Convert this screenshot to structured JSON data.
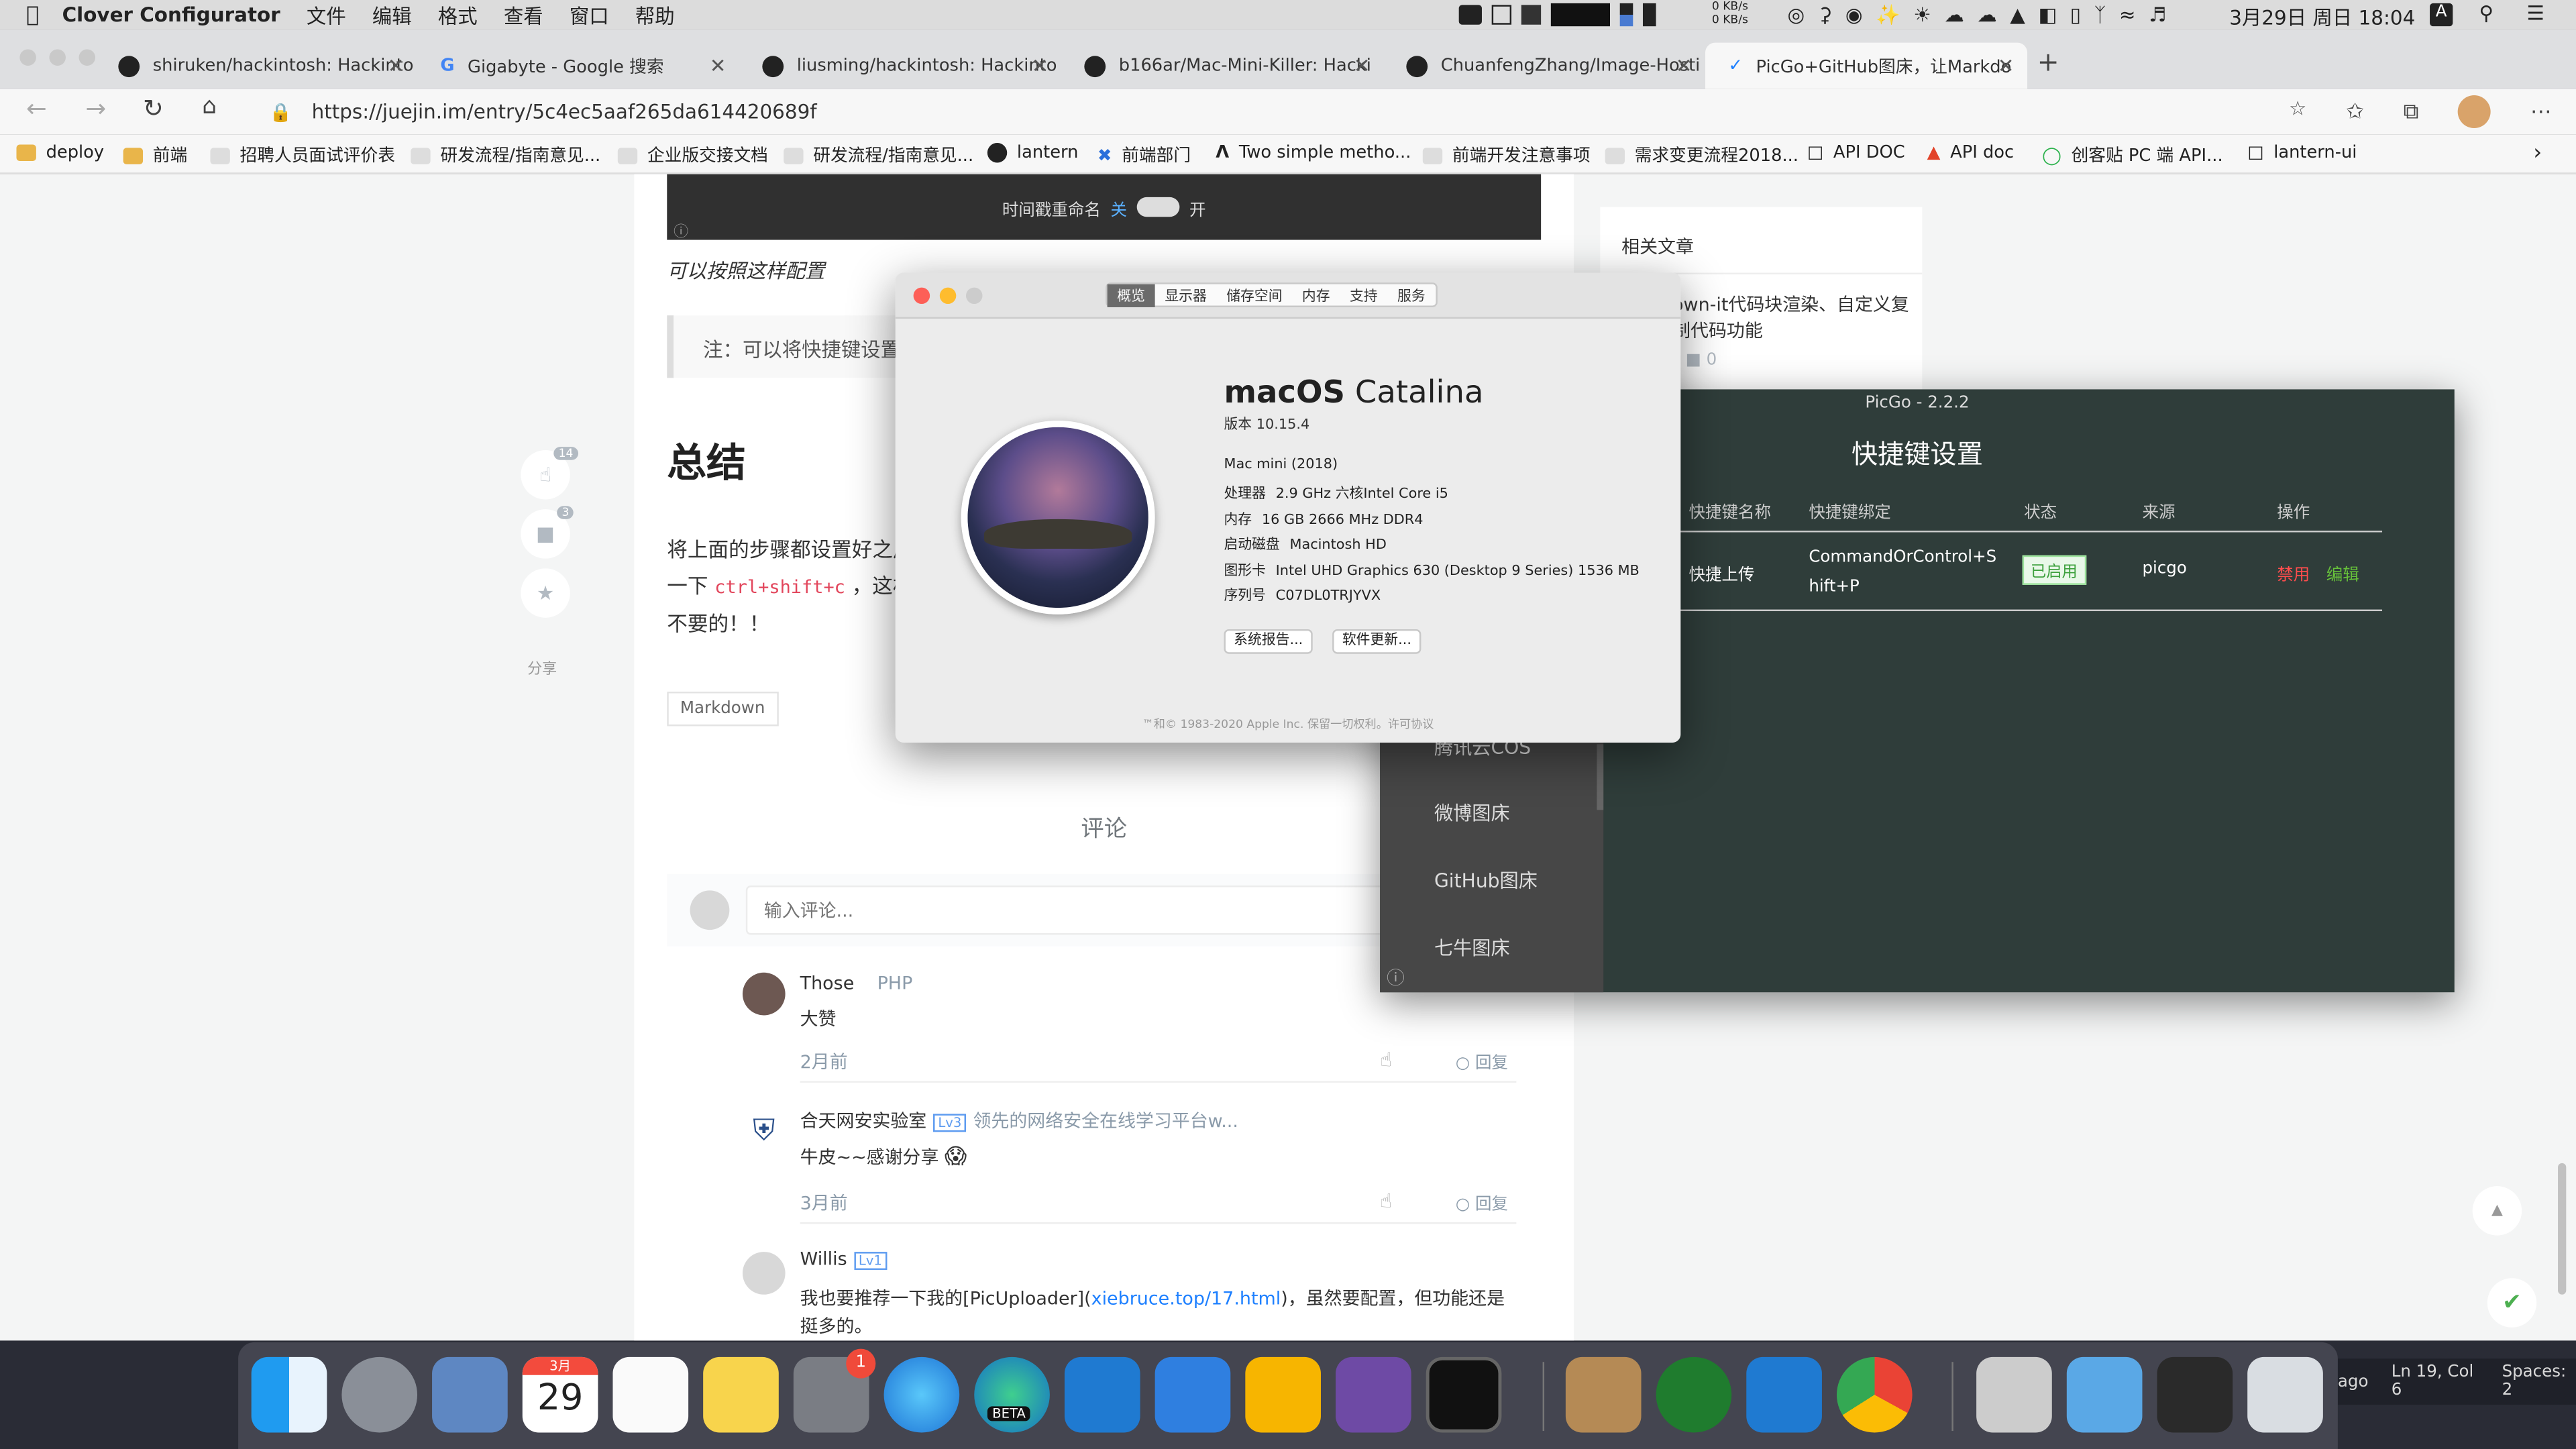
{
  "menubar": {
    "app": "Clover Configurator",
    "menus": [
      "文件",
      "编辑",
      "格式",
      "查看",
      "窗口",
      "帮助"
    ],
    "net_up": "0 KB/s",
    "net_down": "0 KB/s",
    "datetime": "3月29日 周日 18:04",
    "input": "A"
  },
  "tabs": [
    {
      "title": "shiruken/hackintosh: Hackinto",
      "icon": "github-icon"
    },
    {
      "title": "Gigabyte - Google 搜索",
      "icon": "google-icon"
    },
    {
      "title": "liusming/hackintosh: Hackinto",
      "icon": "github-icon"
    },
    {
      "title": "b166ar/Mac-Mini-Killer: Hacki",
      "icon": "github-icon"
    },
    {
      "title": "ChuanfengZhang/Image-Hosti",
      "icon": "github-icon"
    },
    {
      "title": "PicGo+GitHub图床，让Markdo",
      "icon": "juejin-icon"
    }
  ],
  "url": "https://juejin.im/entry/5c4ec5aaf265da614420689f",
  "bookmarks": [
    "deploy",
    "前端",
    "招聘人员面试评价表",
    "研发流程/指南意见...",
    "企业版交接文档",
    "研发流程/指南意见...",
    "lantern",
    "前端部门",
    "Two simple metho...",
    "前端开发注意事项",
    "需求变更流程2018...",
    "API DOC",
    "API doc",
    "创客贴 PC 端 API...",
    "lantern-ui"
  ],
  "article": {
    "toggle_label": "时间戳重命名",
    "toggle_off": "关",
    "toggle_on": "开",
    "caption": "可以按照这样配置",
    "note": "注：可以将快捷键设置",
    "heading": "总结",
    "para1": "将上面的步骤都设置好之后",
    "para2_pre": "一下 ",
    "para2_code": "ctrl+shift+c",
    "para2_post": " ，这样",
    "para3": "不要的！！",
    "tag": "Markdown",
    "like_count": "14",
    "comment_count": "3",
    "share": "分享"
  },
  "related": {
    "title": "相关文章",
    "item": "own-it代码块渲染、自定义复制代码功能",
    "count": "0"
  },
  "comments": {
    "title": "评论",
    "placeholder": "输入评论...",
    "items": [
      {
        "name": "Those",
        "badge": "PHP",
        "text": "大赞",
        "time": "2月前",
        "reply": "回复"
      },
      {
        "name": "合天网安实验室",
        "badge": "Lv3",
        "desc": "领先的网络安全在线学习平台w...",
        "text": "牛皮~~感谢分享",
        "time": "3月前",
        "reply": "回复"
      },
      {
        "name": "Willis",
        "badge": "Lv1",
        "text_pre": "我也要推荐一下我的[PicUploader](",
        "link": "xiebruce.top/17.html",
        "text_post": ")，虽然要配置，但功能还是挺多的。"
      }
    ]
  },
  "about": {
    "tabs": [
      "概览",
      "显示器",
      "储存空间",
      "内存",
      "支持",
      "服务"
    ],
    "os_bold": "macOS",
    "os_name": "Catalina",
    "version": "版本 10.15.4",
    "model": "Mac mini (2018)",
    "specs": [
      {
        "k": "处理器",
        "v": "2.9 GHz 六核Intel Core i5"
      },
      {
        "k": "内存",
        "v": "16 GB 2666 MHz DDR4"
      },
      {
        "k": "启动磁盘",
        "v": "Macintosh HD"
      },
      {
        "k": "图形卡",
        "v": "Intel UHD Graphics 630 (Desktop 9 Series) 1536 MB"
      },
      {
        "k": "序列号",
        "v": "C07DL0TRJYVX"
      }
    ],
    "btn_report": "系统报告...",
    "btn_update": "软件更新...",
    "footer": "™和© 1983-2020 Apple Inc. 保留一切权利。许可协议"
  },
  "picgo": {
    "title": "PicGo - 2.2.2",
    "heading": "快捷键设置",
    "cols": [
      "快捷键名称",
      "快捷键绑定",
      "状态",
      "来源",
      "操作"
    ],
    "row": {
      "name": "快捷上传",
      "binding": "CommandOrControl+Shift+P",
      "status": "已启用",
      "source": "picgo",
      "disable": "禁用",
      "edit": "编辑"
    },
    "menu": [
      "腾讯云COS",
      "微博图床",
      "GitHub图床",
      "七牛图床"
    ]
  },
  "dock": {
    "calendar_month": "3月",
    "calendar_day": "29",
    "badge": "1",
    "beta": "BETA"
  },
  "vscode": {
    "ago": "ago",
    "pos": "Ln 19, Col 6",
    "spaces": "Spaces: 2"
  }
}
